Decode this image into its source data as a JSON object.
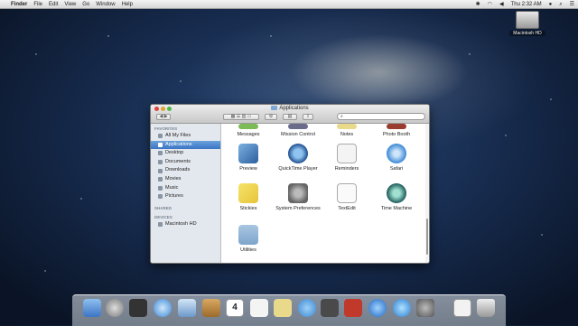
{
  "menubar": {
    "app": "Finder",
    "items": [
      "File",
      "Edit",
      "View",
      "Go",
      "Window",
      "Help"
    ],
    "clock": "Thu 2:32 AM"
  },
  "desktop": {
    "drive_label": "Macintosh HD"
  },
  "window": {
    "title": "Applications",
    "sidebar": {
      "favorites_header": "FAVORITES",
      "favorites": [
        "All My Files",
        "Applications",
        "Desktop",
        "Documents",
        "Downloads",
        "Movies",
        "Music",
        "Pictures"
      ],
      "shared_header": "SHARED",
      "devices_header": "DEVICES",
      "devices": [
        "Macintosh HD"
      ]
    },
    "apps": [
      "Messages",
      "Mission Control",
      "Notes",
      "Photo Booth",
      "Preview",
      "QuickTime Player",
      "Reminders",
      "Safari",
      "Stickies",
      "System Preferences",
      "TextEdit",
      "Time Machine",
      "Utilities"
    ]
  },
  "dock": {
    "calendar_day": "4"
  }
}
